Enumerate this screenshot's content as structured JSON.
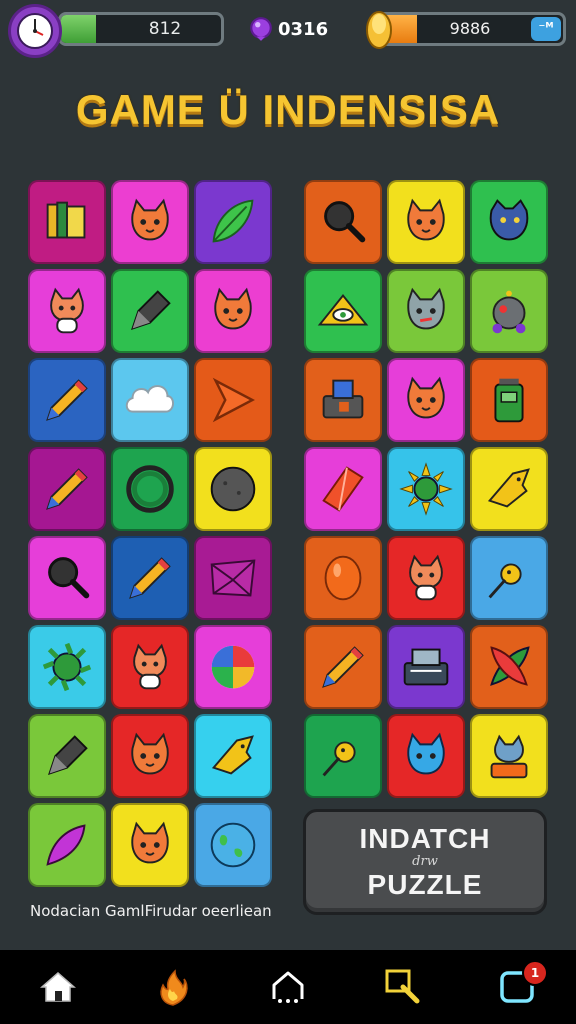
{
  "hud": {
    "timer_value": "812",
    "timer_progress": 0.22,
    "gems_value": "0316",
    "coins_value": "9886",
    "coins_progress": 0.23,
    "coins_button": "⁻ᴹ"
  },
  "title": "GAME Ü INDENSISA",
  "left_grid": [
    {
      "color": "#c01c83",
      "icon": "books-icon"
    },
    {
      "color": "#ec3ed1",
      "icon": "cat-face-icon"
    },
    {
      "color": "#7b38cf",
      "icon": "leaf-icon"
    },
    {
      "color": "#e63ed9",
      "icon": "cat-icon"
    },
    {
      "color": "#2fc04f",
      "icon": "marker-icon"
    },
    {
      "color": "#ec3ed1",
      "icon": "cat-face-icon"
    },
    {
      "color": "#2b64c1",
      "icon": "pencil-icon"
    },
    {
      "color": "#5cc7ee",
      "icon": "cloud-icon"
    },
    {
      "color": "#e45a19",
      "icon": "arrow-gem-icon"
    },
    {
      "color": "#a51792",
      "icon": "pencil-icon"
    },
    {
      "color": "#1ea44f",
      "icon": "ring-icon"
    },
    {
      "color": "#f2e01d",
      "icon": "stone-ball-icon"
    },
    {
      "color": "#e63ed9",
      "icon": "magnifier-icon"
    },
    {
      "color": "#1e5fb3",
      "icon": "pencil-icon"
    },
    {
      "color": "#a81b94",
      "icon": "envelope-gem-icon"
    },
    {
      "color": "#3acbe8",
      "icon": "spiky-ball-icon"
    },
    {
      "color": "#e52727",
      "icon": "cat-icon"
    },
    {
      "color": "#e63ed9",
      "icon": "swirl-icon"
    },
    {
      "color": "#7ac83a",
      "icon": "marker-icon"
    },
    {
      "color": "#e52727",
      "icon": "cat-face-icon"
    },
    {
      "color": "#36d0ee",
      "icon": "fox-flag-icon"
    },
    {
      "color": "#7ac83a",
      "icon": "feather-icon"
    },
    {
      "color": "#f2e01d",
      "icon": "cat-face-icon"
    },
    {
      "color": "#4aa8e6",
      "icon": "globe-icon"
    }
  ],
  "right_grid": [
    {
      "color": "#e2601b",
      "icon": "magnifier-icon"
    },
    {
      "color": "#f2e01d",
      "icon": "cat-face-icon"
    },
    {
      "color": "#2fc04f",
      "icon": "wolf-icon"
    },
    {
      "color": "#2fc04f",
      "icon": "eye-triangle-icon"
    },
    {
      "color": "#7ac83a",
      "icon": "grey-cat-icon"
    },
    {
      "color": "#7ac83a",
      "icon": "robot-icon"
    },
    {
      "color": "#e2601b",
      "icon": "machine-icon"
    },
    {
      "color": "#e63ed9",
      "icon": "cat-face-icon"
    },
    {
      "color": "#e45a19",
      "icon": "trash-bin-icon"
    },
    {
      "color": "#e63ed9",
      "icon": "crystal-icon"
    },
    {
      "color": "#36c3ea",
      "icon": "sun-icon"
    },
    {
      "color": "#f2e01d",
      "icon": "fox-flag-icon"
    },
    {
      "color": "#e2601b",
      "icon": "egg-icon"
    },
    {
      "color": "#e52727",
      "icon": "cat-icon"
    },
    {
      "color": "#4aa8e6",
      "icon": "pin-icon"
    },
    {
      "color": "#e2601b",
      "icon": "pencil-icon"
    },
    {
      "color": "#7b38cf",
      "icon": "cash-register-icon"
    },
    {
      "color": "#e2601b",
      "icon": "cross-leaf-icon"
    },
    {
      "color": "#1ea44f",
      "icon": "pin-icon"
    },
    {
      "color": "#e52727",
      "icon": "blue-cat-icon"
    },
    {
      "color": "#f2e01d",
      "icon": "cat-battery-icon"
    }
  ],
  "match_button": {
    "line1": "INDATCH",
    "line2": "drw",
    "line3": "PUZZLE"
  },
  "caption": "Nodacian GamlFirudar oeerliean",
  "nav": {
    "badge": "1"
  }
}
